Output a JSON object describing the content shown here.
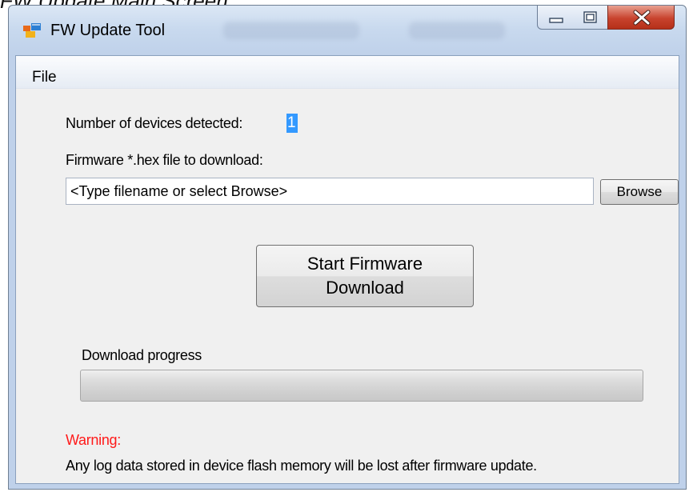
{
  "caption": "FW Update Main Screen",
  "window": {
    "title": "FW Update Tool",
    "controls": {
      "minimize": "minimize",
      "maximize": "maximize",
      "close": "close"
    }
  },
  "menu": {
    "file": "File"
  },
  "devices": {
    "label": "Number of devices detected:",
    "count": "1"
  },
  "firmware": {
    "label": "Firmware *.hex file to download:",
    "input_value": "<Type filename or select Browse>",
    "browse_label": "Browse"
  },
  "start_button": {
    "line1": "Start Firmware",
    "line2": "Download"
  },
  "progress": {
    "label": "Download progress",
    "percent": 0
  },
  "warning": {
    "title": "Warning:",
    "message": "Any log data stored in device flash memory will be lost after firmware update."
  },
  "colors": {
    "warning": "#ff1a1a",
    "selection": "#3399ff",
    "close_button": "#c8432e"
  },
  "icons": {
    "app": "app-window-icon",
    "minimize": "minimize-icon",
    "maximize": "maximize-icon",
    "close": "close-icon"
  }
}
